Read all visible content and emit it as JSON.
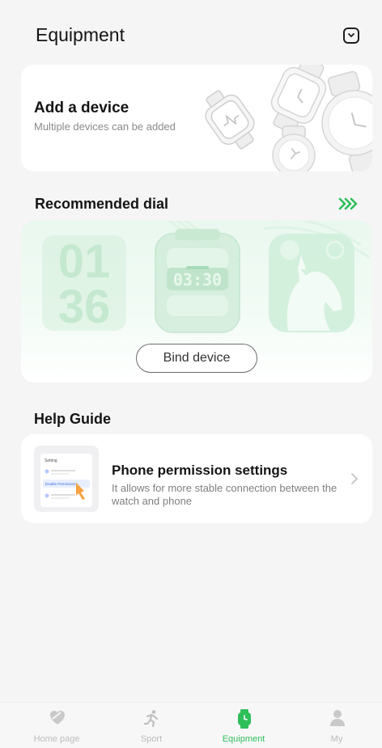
{
  "header": {
    "title": "Equipment"
  },
  "add_device": {
    "title": "Add a device",
    "subtitle": "Multiple devices can be added"
  },
  "recommended": {
    "title": "Recommended dial",
    "dial_digits_1": "01",
    "dial_digits_2": "36",
    "dial_time": "03:30",
    "bind_label": "Bind device"
  },
  "help": {
    "title": "Help Guide",
    "item_title": "Phone permission settings",
    "item_desc": "It allows for more stable connection between the watch and phone",
    "thumb_heading": "Setting",
    "thumb_row_label": "Enable Permissions"
  },
  "tabs": [
    {
      "label": "Home page",
      "icon": "heart-shield-icon",
      "active": false
    },
    {
      "label": "Sport",
      "icon": "runner-icon",
      "active": false
    },
    {
      "label": "Equipment",
      "icon": "watch-icon",
      "active": true
    },
    {
      "label": "My",
      "icon": "person-icon",
      "active": false
    }
  ],
  "colors": {
    "accent": "#2fbf5a",
    "background": "#f5f5f6",
    "card": "#ffffff"
  }
}
